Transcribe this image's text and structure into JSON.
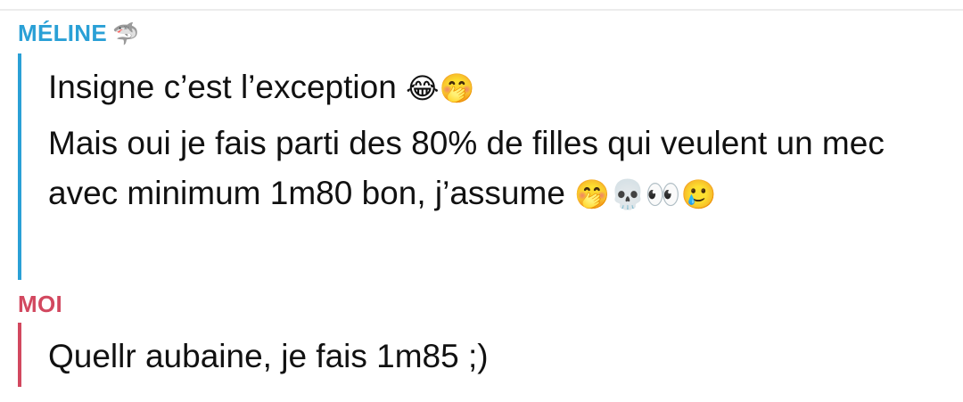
{
  "conversation": {
    "messages_from_meline": {
      "sender_name": "MÉLINE",
      "sender_emoji": "🦈",
      "messages": [
        {
          "text": "Insigne c’est l’exception ",
          "emojis": "😂🤭"
        },
        {
          "text": "Mais oui je fais parti des 80% de filles qui veulent un mec avec minimum 1m80 bon, j’assume ",
          "emojis": "🤭💀👀🥲"
        }
      ],
      "accent_color": "#2aa0d6"
    },
    "messages_from_moi": {
      "sender_name": "MOI",
      "messages": [
        {
          "text": "Quellr aubaine, je fais 1m85 ;)"
        }
      ],
      "accent_color": "#d2485f"
    }
  }
}
